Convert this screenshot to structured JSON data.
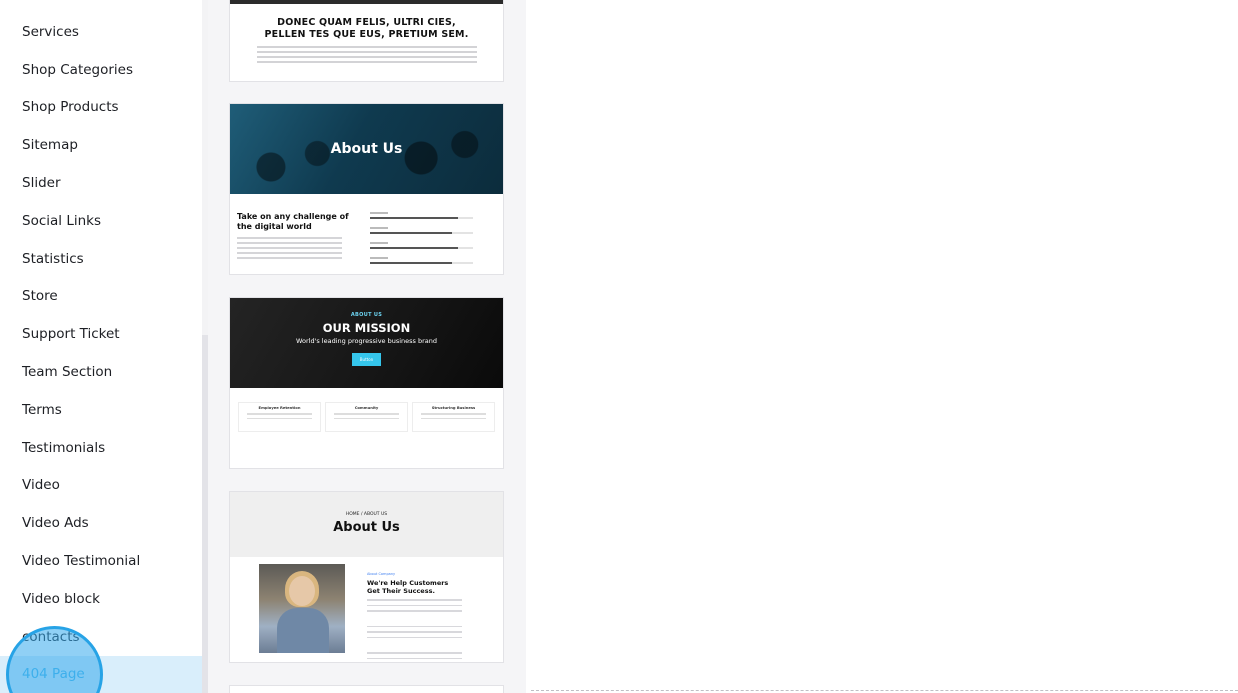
{
  "sidebar": {
    "items": [
      {
        "label": "Services"
      },
      {
        "label": "Shop Categories"
      },
      {
        "label": "Shop Products"
      },
      {
        "label": "Sitemap"
      },
      {
        "label": "Slider"
      },
      {
        "label": "Social Links"
      },
      {
        "label": "Statistics"
      },
      {
        "label": "Store"
      },
      {
        "label": "Support Ticket"
      },
      {
        "label": "Team Section"
      },
      {
        "label": "Terms"
      },
      {
        "label": "Testimonials"
      },
      {
        "label": "Video"
      },
      {
        "label": "Video Ads"
      },
      {
        "label": "Video Testimonial"
      },
      {
        "label": "Video block"
      },
      {
        "label": "contacts"
      },
      {
        "label": "404 Page",
        "selected": true
      }
    ]
  },
  "templates": {
    "card1": {
      "heading_line1": "DONEC QUAM FELIS, ULTRI CIES,",
      "heading_line2": "PELLEN TES QUE EUS, PRETIUM SEM."
    },
    "card2": {
      "hero_title": "About Us",
      "subheading": "Take on any challenge of the digital world",
      "bar_levels": [
        0.85,
        0.8,
        0.85,
        0.8
      ]
    },
    "card3": {
      "eyebrow": "ABOUT US",
      "title": "OUR MISSION",
      "subtitle": "World's leading progressive business brand",
      "button": "Button",
      "features": [
        "Employee Retention",
        "Community",
        "Structuring Business"
      ]
    },
    "card4": {
      "breadcrumb": "HOME / ABOUT US",
      "title": "About Us",
      "tag": "About Company",
      "headline": "We're Help Customers Get Their Success."
    }
  },
  "colors": {
    "accent": "#47b6ea",
    "selected_bg": "#d9eefb",
    "mission_button": "#35c6ec"
  }
}
